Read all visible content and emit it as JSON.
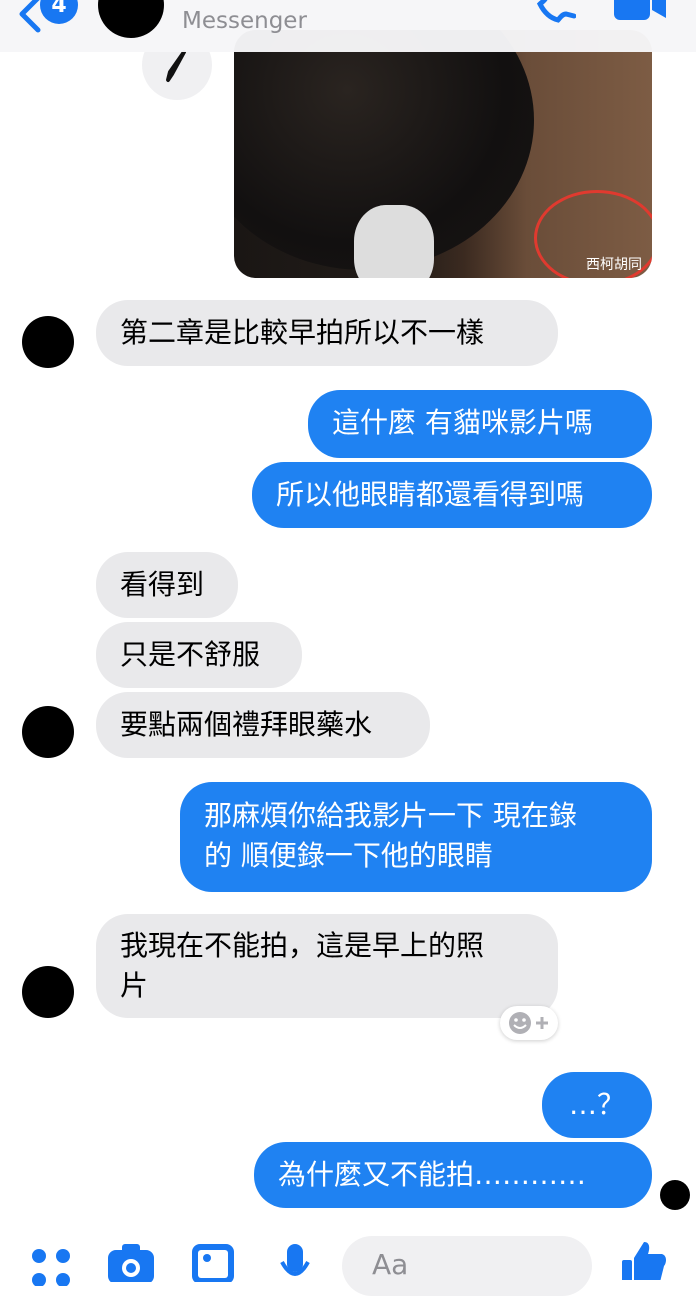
{
  "header": {
    "unread_count": "4",
    "contact_name": "",
    "subtitle": "Messenger"
  },
  "photo": {
    "watermark": "西柯胡同"
  },
  "messages": [
    {
      "dir": "in",
      "text": "第二章是比較早拍所以不一樣"
    },
    {
      "dir": "out",
      "text": "這什麼 有貓咪影片嗎"
    },
    {
      "dir": "out",
      "text": "所以他眼睛都還看得到嗎"
    },
    {
      "dir": "in",
      "text": "看得到"
    },
    {
      "dir": "in",
      "text": "只是不舒服"
    },
    {
      "dir": "in",
      "text": "要點兩個禮拜眼藥水"
    },
    {
      "dir": "out",
      "line1": "那麻煩你給我影片一下 現在錄",
      "line2": "的 順便錄一下他的眼睛"
    },
    {
      "dir": "in",
      "line1": "我現在不能拍，這是早上的照",
      "line2": "片"
    },
    {
      "dir": "out",
      "text": "…？"
    },
    {
      "dir": "out",
      "text": "為什麼又不能拍…………"
    }
  ],
  "composer": {
    "placeholder": "Aa"
  },
  "colors": {
    "accent": "#1f82f2",
    "incoming": "#e9e9eb"
  }
}
